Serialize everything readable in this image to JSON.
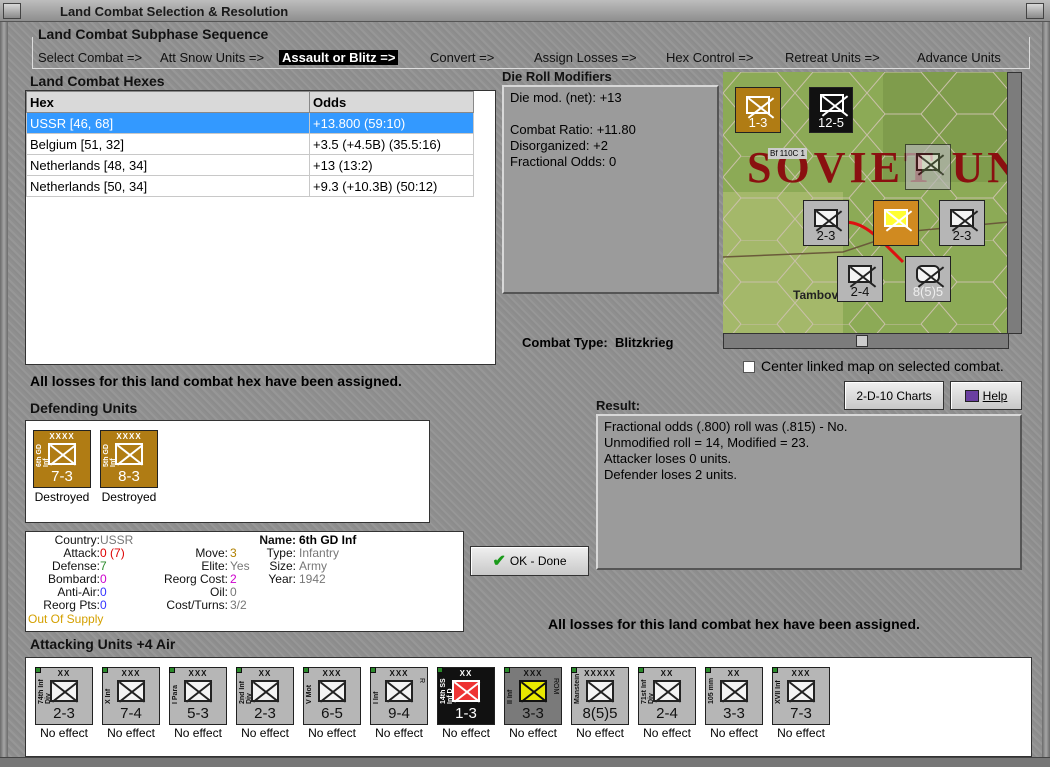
{
  "window": {
    "title": "Land Combat Selection & Resolution"
  },
  "subphase": {
    "title": "Land Combat Subphase Sequence",
    "steps": [
      "Select Combat =>",
      "Att Snow Units =>",
      "Assault or Blitz =>",
      "Convert =>",
      "Assign Losses =>",
      "Hex Control =>",
      "Retreat Units =>",
      "Advance Units"
    ],
    "selected_index": 2
  },
  "combat_hexes": {
    "title": "Land Combat Hexes",
    "columns": [
      "Hex",
      "Odds"
    ],
    "rows": [
      {
        "hex": "USSR [46, 68]",
        "odds": "+13.800 (59:10)"
      },
      {
        "hex": "Belgium [51, 32]",
        "odds": "+3.5 (+4.5B) (35.5:16)"
      },
      {
        "hex": "Netherlands [48, 34]",
        "odds": "+13 (13:2)"
      },
      {
        "hex": "Netherlands [50, 34]",
        "odds": "+9.3 (+10.3B) (50:12)"
      }
    ],
    "selected_row": 0
  },
  "die_roll": {
    "title": "Die Roll Modifiers",
    "net": "Die mod. (net): +13",
    "combat_ratio": "Combat Ratio: +11.80",
    "disorganized": "Disorganized: +2",
    "fractional": "Fractional Odds: 0"
  },
  "combat_type": {
    "label": "Combat Type:",
    "value": "Blitzkrieg"
  },
  "losses_msg": "All losses for this land combat hex have been assigned.",
  "center_map": {
    "label": "Center linked map on selected combat.",
    "checked": false
  },
  "buttons": {
    "charts": "2-D-10 Charts",
    "help": "Help",
    "ok": "OK - Done"
  },
  "result": {
    "title": "Result:",
    "lines": [
      "Fractional odds (.800) roll was (.815)  - No.",
      "Unmodified roll = 14, Modified = 23.",
      "Attacker loses 0 units.",
      "Defender loses 2 units."
    ]
  },
  "defending": {
    "title": "Defending Units",
    "units": [
      {
        "size": "XXXX",
        "name": "6th GD Inf",
        "value": "7-3",
        "status": "Destroyed"
      },
      {
        "size": "XXXX",
        "name": "5th GD Inf",
        "value": "8-3",
        "status": "Destroyed"
      }
    ]
  },
  "unit_info": {
    "country_l": "Country:",
    "country": "USSR",
    "attack_l": "Attack:",
    "attack": "0",
    "attack2": "(7)",
    "defense_l": "Defense:",
    "defense": "7",
    "bombard_l": "Bombard:",
    "bombard": "0",
    "antiair_l": "Anti-Air:",
    "antiair": "0",
    "reorgpts_l": "Reorg Pts:",
    "reorgpts": "0",
    "supply": "Out Of Supply",
    "move_l": "Move:",
    "move": "3",
    "elite_l": "Elite:",
    "elite": "Yes",
    "reorgcost_l": "Reorg Cost:",
    "reorgcost": "2",
    "oil_l": "Oil:",
    "oil": "0",
    "costturns_l": "Cost/Turns:",
    "costturns": "3/2",
    "name_l": "Name:",
    "name": "6th GD Inf",
    "type_l": "Type:",
    "type": "Infantry",
    "size_l": "Size:",
    "size": "Army",
    "year_l": "Year:",
    "year": "1942"
  },
  "attacking": {
    "title": "Attacking Units +4 Air",
    "units": [
      {
        "size": "XX",
        "name": "74th Inf Div",
        "value": "2-3",
        "status": "No effect",
        "style": "grey"
      },
      {
        "size": "XXX",
        "name": "X Inf",
        "value": "7-4",
        "status": "No effect",
        "style": "grey"
      },
      {
        "size": "XXX",
        "name": "I Para",
        "value": "5-3",
        "status": "No effect",
        "style": "grey"
      },
      {
        "size": "XX",
        "name": "2nd Inf Div",
        "value": "2-3",
        "status": "No effect",
        "style": "grey"
      },
      {
        "size": "XXX",
        "name": "V Mot",
        "value": "6-5",
        "status": "No effect",
        "style": "grey"
      },
      {
        "size": "XXX",
        "name": "I Inf",
        "value": "9-4",
        "status": "No effect",
        "style": "grey",
        "mark": "R"
      },
      {
        "size": "XX",
        "name": "14th SS Inf D",
        "value": "1-3",
        "status": "No effect",
        "style": "black"
      },
      {
        "size": "XXX",
        "name": "II Inf",
        "value": "3-3",
        "status": "No effect",
        "style": "dgrey",
        "mark": "ROM"
      },
      {
        "size": "XXXXX",
        "name": "Manstein",
        "value": "8(5)5",
        "status": "No effect",
        "style": "grey"
      },
      {
        "size": "XX",
        "name": "71st Inf Div",
        "value": "2-4",
        "status": "No effect",
        "style": "grey"
      },
      {
        "size": "XX",
        "name": "105 mm",
        "value": "3-3",
        "status": "No effect",
        "style": "grey"
      },
      {
        "size": "XXX",
        "name": "XVII Inf",
        "value": "7-3",
        "status": "No effect",
        "style": "grey"
      }
    ]
  },
  "map": {
    "label_big": "SOVIET UNION",
    "place": "Tambov",
    "units": [
      {
        "v": "1-3",
        "n": "3"
      },
      {
        "v": "12-5",
        "n": "2"
      },
      {
        "v": "2-3",
        "n": "2"
      },
      {
        "v": "2-3",
        "n": "3"
      },
      {
        "v": "2-4",
        "n": "4"
      },
      {
        "v": "8(5)5",
        "n": "3"
      }
    ],
    "tag": "Bf 110C 1"
  }
}
